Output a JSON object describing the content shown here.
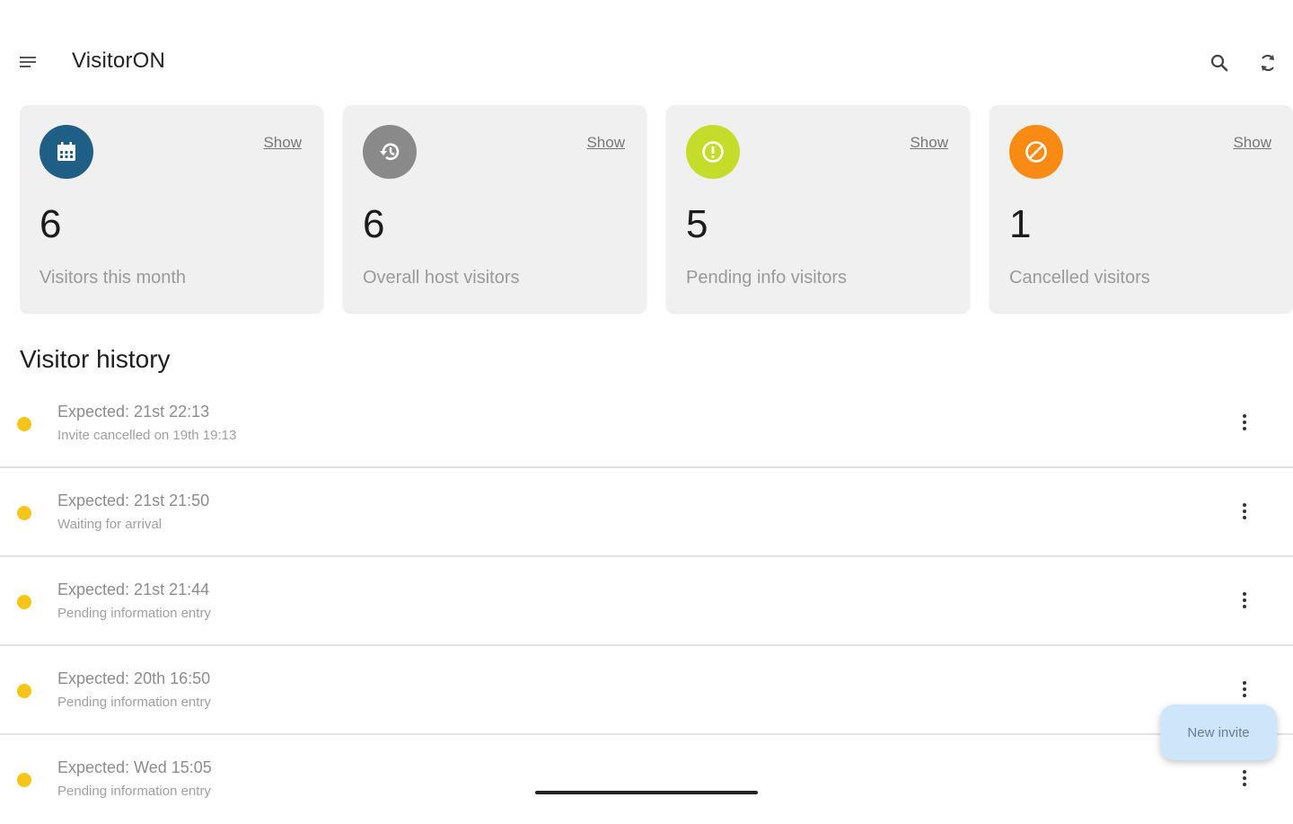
{
  "app": {
    "title": "VisitorON"
  },
  "toolbar": {
    "menu_icon": "menu-icon",
    "search_icon": "search-icon",
    "refresh_icon": "refresh-icon"
  },
  "cards": [
    {
      "icon": "calendar-icon",
      "icon_bg": "#1f5f86",
      "show_label": "Show",
      "count": "6",
      "label": "Visitors this month"
    },
    {
      "icon": "history-icon",
      "icon_bg": "#8a8a8a",
      "show_label": "Show",
      "count": "6",
      "label": "Overall host visitors"
    },
    {
      "icon": "alert-icon",
      "icon_bg": "#c6dc2a",
      "show_label": "Show",
      "count": "5",
      "label": "Pending info visitors"
    },
    {
      "icon": "cancel-icon",
      "icon_bg": "#f98b14",
      "show_label": "Show",
      "count": "1",
      "label": "Cancelled visitors"
    }
  ],
  "history": {
    "title": "Visitor history",
    "status_dot_color": "#f5c518",
    "items": [
      {
        "title": "Expected: 21st 22:13",
        "subtitle": "Invite cancelled on 19th 19:13"
      },
      {
        "title": "Expected: 21st 21:50",
        "subtitle": "Waiting for arrival"
      },
      {
        "title": "Expected: 21st 21:44",
        "subtitle": "Pending information entry"
      },
      {
        "title": "Expected: 20th 16:50",
        "subtitle": "Pending information entry"
      },
      {
        "title": "Expected: Wed 15:05",
        "subtitle": "Pending information entry"
      }
    ]
  },
  "fab": {
    "label": "New invite"
  }
}
